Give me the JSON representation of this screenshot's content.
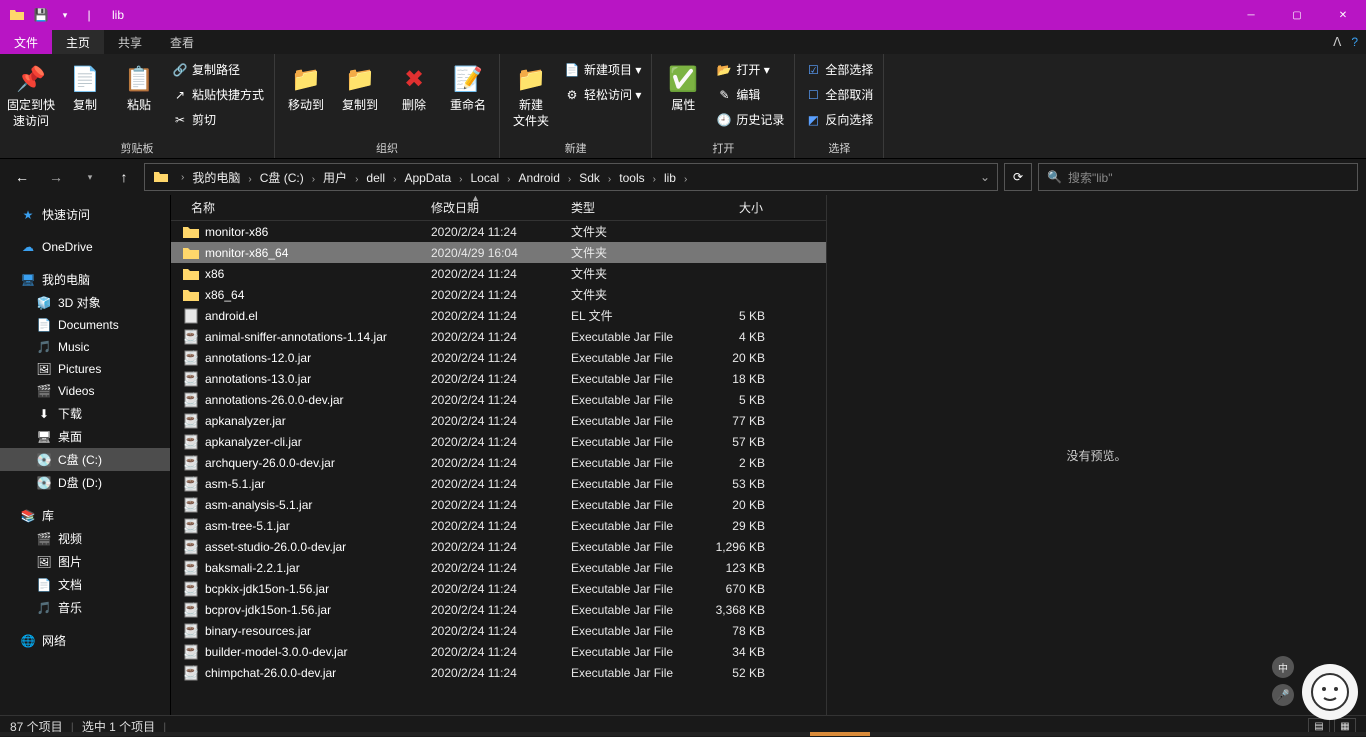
{
  "window": {
    "title": "lib"
  },
  "menus": {
    "file": "文件",
    "home": "主页",
    "share": "共享",
    "view": "查看"
  },
  "ribbon": {
    "clipboard": {
      "label": "剪贴板",
      "pin": "固定到快\n速访问",
      "copy": "复制",
      "paste": "粘贴",
      "copyPath": "复制路径",
      "pasteShortcut": "粘贴快捷方式",
      "cut": "剪切"
    },
    "organize": {
      "label": "组织",
      "moveTo": "移动到",
      "copyTo": "复制到",
      "delete": "删除",
      "rename": "重命名"
    },
    "new": {
      "label": "新建",
      "newFolder": "新建\n文件夹",
      "newItem": "新建项目 ▾",
      "easyAccess": "轻松访问 ▾"
    },
    "open": {
      "label": "打开",
      "properties": "属性",
      "open": "打开 ▾",
      "edit": "编辑",
      "history": "历史记录"
    },
    "select": {
      "label": "选择",
      "selectAll": "全部选择",
      "selectNone": "全部取消",
      "invert": "反向选择"
    }
  },
  "breadcrumb": [
    "我的电脑",
    "C盘 (C:)",
    "用户",
    "dell",
    "AppData",
    "Local",
    "Android",
    "Sdk",
    "tools",
    "lib"
  ],
  "search": {
    "placeholder": "搜索\"lib\""
  },
  "sidebar": {
    "quickAccess": "快速访问",
    "oneDrive": "OneDrive",
    "thisPC": "我的电脑",
    "thisPCItems": [
      {
        "label": "3D 对象",
        "icon": "cube"
      },
      {
        "label": "Documents",
        "icon": "doc"
      },
      {
        "label": "Music",
        "icon": "music"
      },
      {
        "label": "Pictures",
        "icon": "pic"
      },
      {
        "label": "Videos",
        "icon": "video"
      },
      {
        "label": "下载",
        "icon": "download"
      },
      {
        "label": "桌面",
        "icon": "desktop"
      },
      {
        "label": "C盘 (C:)",
        "icon": "drive",
        "selected": true
      },
      {
        "label": "D盘 (D:)",
        "icon": "drive"
      }
    ],
    "libraries": "库",
    "librariesItems": [
      {
        "label": "视频",
        "icon": "video"
      },
      {
        "label": "图片",
        "icon": "pic"
      },
      {
        "label": "文档",
        "icon": "doc"
      },
      {
        "label": "音乐",
        "icon": "music"
      }
    ],
    "network": "网络"
  },
  "columns": {
    "name": "名称",
    "date": "修改日期",
    "type": "类型",
    "size": "大小"
  },
  "files": [
    {
      "name": "monitor-x86",
      "date": "2020/2/24 11:24",
      "type": "文件夹",
      "size": "",
      "icon": "folder"
    },
    {
      "name": "monitor-x86_64",
      "date": "2020/4/29 16:04",
      "type": "文件夹",
      "size": "",
      "icon": "folder",
      "selected": true
    },
    {
      "name": "x86",
      "date": "2020/2/24 11:24",
      "type": "文件夹",
      "size": "",
      "icon": "folder"
    },
    {
      "name": "x86_64",
      "date": "2020/2/24 11:24",
      "type": "文件夹",
      "size": "",
      "icon": "folder"
    },
    {
      "name": "android.el",
      "date": "2020/2/24 11:24",
      "type": "EL 文件",
      "size": "5 KB",
      "icon": "file"
    },
    {
      "name": "animal-sniffer-annotations-1.14.jar",
      "date": "2020/2/24 11:24",
      "type": "Executable Jar File",
      "size": "4 KB",
      "icon": "jar"
    },
    {
      "name": "annotations-12.0.jar",
      "date": "2020/2/24 11:24",
      "type": "Executable Jar File",
      "size": "20 KB",
      "icon": "jar"
    },
    {
      "name": "annotations-13.0.jar",
      "date": "2020/2/24 11:24",
      "type": "Executable Jar File",
      "size": "18 KB",
      "icon": "jar"
    },
    {
      "name": "annotations-26.0.0-dev.jar",
      "date": "2020/2/24 11:24",
      "type": "Executable Jar File",
      "size": "5 KB",
      "icon": "jar"
    },
    {
      "name": "apkanalyzer.jar",
      "date": "2020/2/24 11:24",
      "type": "Executable Jar File",
      "size": "77 KB",
      "icon": "jar"
    },
    {
      "name": "apkanalyzer-cli.jar",
      "date": "2020/2/24 11:24",
      "type": "Executable Jar File",
      "size": "57 KB",
      "icon": "jar"
    },
    {
      "name": "archquery-26.0.0-dev.jar",
      "date": "2020/2/24 11:24",
      "type": "Executable Jar File",
      "size": "2 KB",
      "icon": "jar"
    },
    {
      "name": "asm-5.1.jar",
      "date": "2020/2/24 11:24",
      "type": "Executable Jar File",
      "size": "53 KB",
      "icon": "jar"
    },
    {
      "name": "asm-analysis-5.1.jar",
      "date": "2020/2/24 11:24",
      "type": "Executable Jar File",
      "size": "20 KB",
      "icon": "jar"
    },
    {
      "name": "asm-tree-5.1.jar",
      "date": "2020/2/24 11:24",
      "type": "Executable Jar File",
      "size": "29 KB",
      "icon": "jar"
    },
    {
      "name": "asset-studio-26.0.0-dev.jar",
      "date": "2020/2/24 11:24",
      "type": "Executable Jar File",
      "size": "1,296 KB",
      "icon": "jar"
    },
    {
      "name": "baksmali-2.2.1.jar",
      "date": "2020/2/24 11:24",
      "type": "Executable Jar File",
      "size": "123 KB",
      "icon": "jar"
    },
    {
      "name": "bcpkix-jdk15on-1.56.jar",
      "date": "2020/2/24 11:24",
      "type": "Executable Jar File",
      "size": "670 KB",
      "icon": "jar"
    },
    {
      "name": "bcprov-jdk15on-1.56.jar",
      "date": "2020/2/24 11:24",
      "type": "Executable Jar File",
      "size": "3,368 KB",
      "icon": "jar"
    },
    {
      "name": "binary-resources.jar",
      "date": "2020/2/24 11:24",
      "type": "Executable Jar File",
      "size": "78 KB",
      "icon": "jar"
    },
    {
      "name": "builder-model-3.0.0-dev.jar",
      "date": "2020/2/24 11:24",
      "type": "Executable Jar File",
      "size": "34 KB",
      "icon": "jar"
    },
    {
      "name": "chimpchat-26.0.0-dev.jar",
      "date": "2020/2/24 11:24",
      "type": "Executable Jar File",
      "size": "52 KB",
      "icon": "jar"
    }
  ],
  "preview": {
    "noPreview": "没有预览。"
  },
  "status": {
    "itemCount": "87 个项目",
    "selected": "选中 1 个项目"
  }
}
